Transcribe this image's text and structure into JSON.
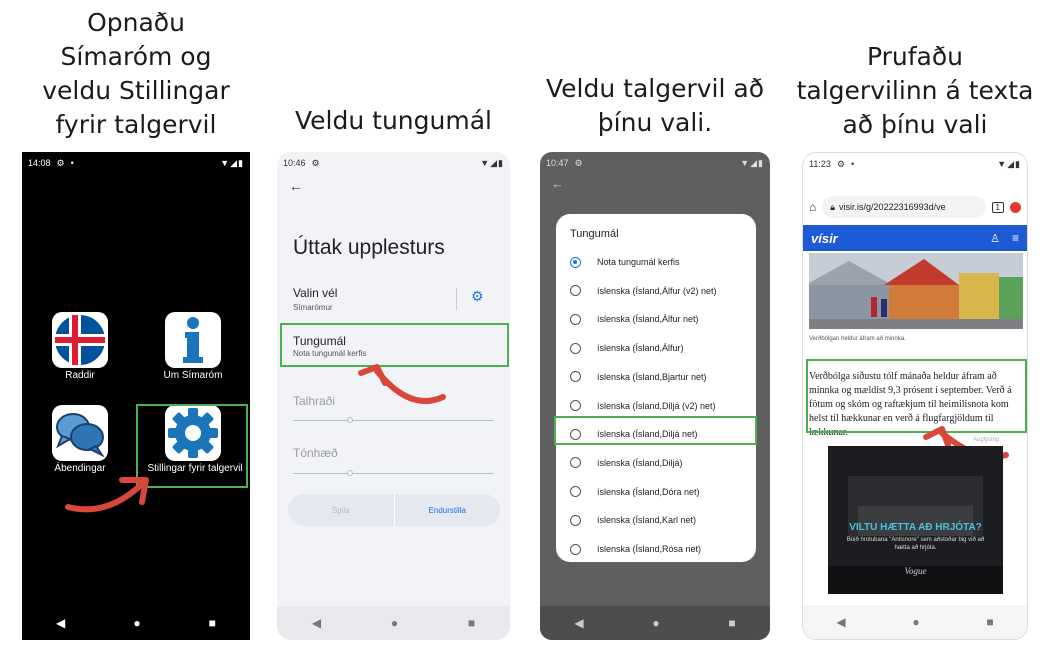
{
  "captions": {
    "step1": [
      "Opnaðu",
      "Símaróm og",
      "veldu Stillingar",
      "fyrir talgervil"
    ],
    "step2": [
      "Veldu tungumál"
    ],
    "step3": [
      "Veldu talgervil að",
      "þínu vali."
    ],
    "step4": [
      "Prufaðu",
      "talgervilinn á texta",
      "að þínu vali"
    ]
  },
  "phone1": {
    "time": "14:08",
    "apps": [
      "Raddir",
      "Um Símaróm",
      "Ábendingar",
      "Stillingar fyrir talgervil"
    ]
  },
  "phone2": {
    "time": "10:46",
    "title": "Úttak upplesturs",
    "engine_label": "Valin vél",
    "engine_value": "Símarómur",
    "language_label": "Tungumál",
    "language_value": "Nota tungumál kerfis",
    "speed_label": "Talhraði",
    "pitch_label": "Tónhæð",
    "play_button": "Spila",
    "reset_button": "Endurstilla"
  },
  "phone3": {
    "time": "10:47",
    "dialog_title": "Tungumál",
    "options": [
      "Nota tungumál kerfis",
      "íslenska (Ísland,Álfur (v2) net)",
      "íslenska (Ísland,Álfur net)",
      "íslenska (Ísland,Álfur)",
      "íslenska (Ísland,Bjartur net)",
      "íslenska (Ísland,Diljá (v2) net)",
      "íslenska (Ísland,Diljá net)",
      "íslenska (Ísland,Diljá)",
      "íslenska (Ísland,Dóra net)",
      "íslenska (Ísland,Karl net)",
      "íslenska (Ísland,Rósa net)"
    ],
    "selected_index": 0,
    "highlighted_index": 6
  },
  "phone4": {
    "time": "11:23",
    "url": "visir.is/g/20222316993d/ve",
    "tab_count": "1",
    "site_logo": "vísir",
    "photo_caption": "Verðbólgan heldur áfram að minnka.",
    "article_text": "Verðbólga síðustu tólf mánaða heldur áfram að minnka og mældist 9,3 prósent í september. Verð á fötum og skóm og raftækjum til heimilisnota kom helst til hækkunar en verð á flugfargjöldum til lækkunar.",
    "ad_label": "Auglýsing",
    "ad_headline": "VILTU HÆTTA AÐ HRJÓTA?",
    "ad_body": "Búið hrotubana \"Antisnore\" sem aðstoðar big við að hætta að hrjóta.",
    "ad_brand": "Vogue"
  },
  "colors": {
    "highlight": "#4caf50",
    "arrow": "#d9463a",
    "accent_blue": "#1a73e8",
    "visir_blue": "#1d5bd6"
  }
}
